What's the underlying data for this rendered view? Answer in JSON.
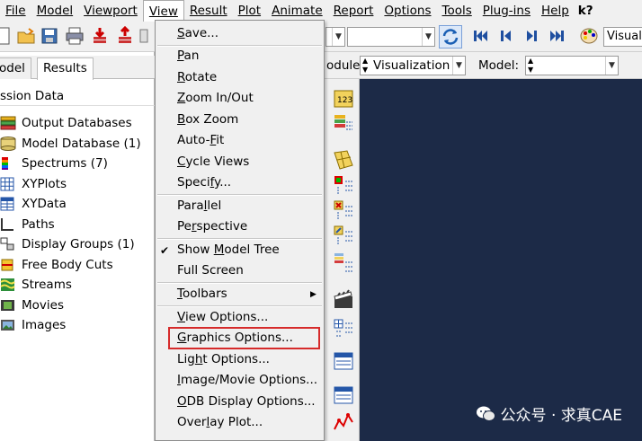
{
  "menubar": {
    "items": [
      "File",
      "Model",
      "Viewport",
      "View",
      "Result",
      "Plot",
      "Animate",
      "Report",
      "Options",
      "Tools",
      "Plug-ins",
      "Help"
    ],
    "help_icon": "k?"
  },
  "toolbar": {
    "combo_right_text": "Visual"
  },
  "context_bar": {
    "module_label": "odule:",
    "module_value": "Visualization",
    "model_label": "Model:"
  },
  "left_panel": {
    "tabs": [
      "odel",
      "Results"
    ],
    "section_title": "ssion Data",
    "tree_items": [
      "Output Databases",
      "Model Database (1)",
      "Spectrums (7)",
      "XYPlots",
      "XYData",
      "Paths",
      "Display Groups (1)",
      "Free Body Cuts",
      "Streams",
      "Movies",
      "Images"
    ]
  },
  "view_menu": {
    "items": [
      {
        "label": "Save...",
        "u": "S",
        "rest": "ave..."
      },
      {
        "label": "Pan",
        "u": "P",
        "rest": "an"
      },
      {
        "label": "Rotate",
        "u": "R",
        "rest": "otate"
      },
      {
        "label": "Zoom In/Out",
        "u": "Z",
        "rest": "oom In/Out"
      },
      {
        "label": "Box Zoom",
        "u": "B",
        "rest": "ox Zoom"
      },
      {
        "label": "Auto-Fit",
        "pre": "Auto-",
        "u": "F",
        "rest": "it"
      },
      {
        "label": "Cycle Views",
        "u": "C",
        "rest": "ycle Views"
      },
      {
        "label": "Specify...",
        "pre": "Speci",
        "u": "f",
        "rest": "y..."
      },
      {
        "label": "Parallel",
        "pre": "Para",
        "u": "l",
        "rest": "lel"
      },
      {
        "label": "Perspective",
        "pre": "Pe",
        "u": "r",
        "rest": "spective"
      },
      {
        "label": "Show Model Tree",
        "pre": "Show ",
        "u": "M",
        "rest": "odel Tree"
      },
      {
        "label": "Full Screen"
      },
      {
        "label": "Toolbars",
        "u": "T",
        "rest": "oolbars"
      },
      {
        "label": "View Options...",
        "u": "V",
        "rest": "iew Options..."
      },
      {
        "label": "Graphics Options...",
        "u": "G",
        "rest": "raphics Options..."
      },
      {
        "label": "Light Options...",
        "pre": "Lig",
        "u": "h",
        "rest": "t Options..."
      },
      {
        "label": "Image/Movie Options...",
        "u": "I",
        "rest": "mage/Movie Options..."
      },
      {
        "label": "ODB Display Options...",
        "u": "O",
        "rest": "DB Display Options..."
      },
      {
        "label": "Overlay Plot...",
        "pre": "Over",
        "u": "l",
        "rest": "ay Plot..."
      }
    ]
  },
  "watermark": {
    "text": "公众号 · 求真CAE"
  },
  "colors": {
    "viewport_bg": "#1c2a47",
    "highlight": "#d62b2b"
  }
}
